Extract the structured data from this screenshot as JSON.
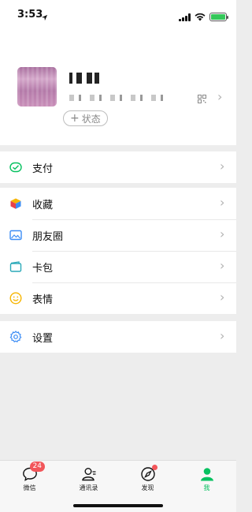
{
  "status_bar": {
    "time": "3:53"
  },
  "profile": {
    "status_button": "状态"
  },
  "menu": {
    "groups": [
      {
        "items": [
          {
            "label": "支付",
            "icon": "pay-icon"
          }
        ]
      },
      {
        "items": [
          {
            "label": "收藏",
            "icon": "favorites-icon"
          },
          {
            "label": "朋友圈",
            "icon": "moments-icon"
          },
          {
            "label": "卡包",
            "icon": "card-wallet-icon"
          },
          {
            "label": "表情",
            "icon": "stickers-icon"
          }
        ]
      },
      {
        "items": [
          {
            "label": "设置",
            "icon": "settings-icon"
          }
        ]
      }
    ]
  },
  "tabbar": {
    "tabs": [
      {
        "label": "微信",
        "icon": "chat-bubble-icon",
        "badge": "24"
      },
      {
        "label": "通讯录",
        "icon": "contacts-icon"
      },
      {
        "label": "发现",
        "icon": "compass-icon"
      },
      {
        "label": "我",
        "icon": "person-icon",
        "active": true
      }
    ]
  },
  "colors": {
    "accent": "#07c160",
    "badge": "#f2565a",
    "background": "#ededed"
  }
}
